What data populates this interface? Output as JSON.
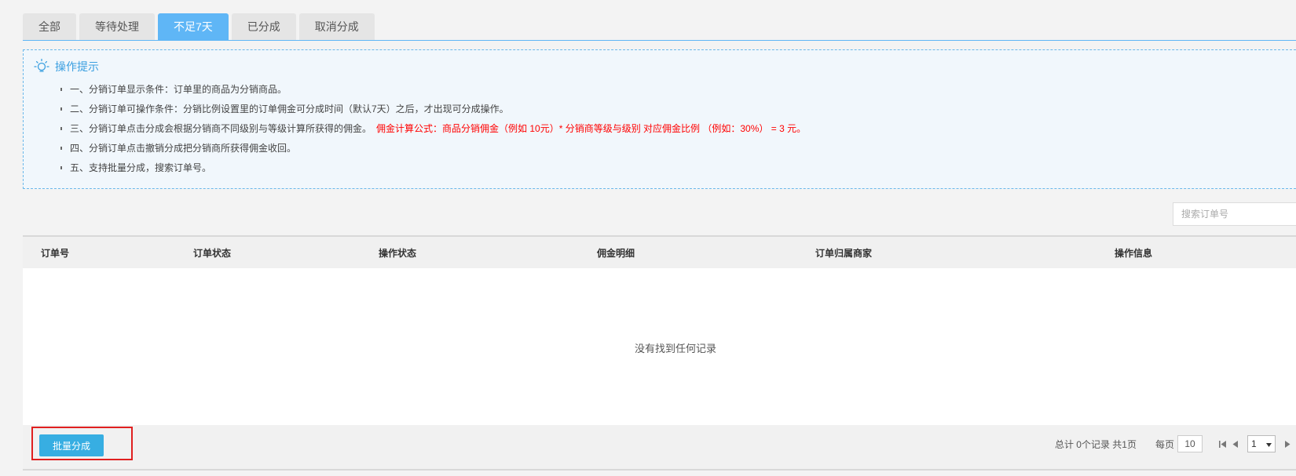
{
  "tabs": [
    {
      "label": "全部"
    },
    {
      "label": "等待处理"
    },
    {
      "label": "不足7天"
    },
    {
      "label": "已分成"
    },
    {
      "label": "取消分成"
    }
  ],
  "tips": {
    "title": "操作提示",
    "icon": "lightbulb-icon",
    "items": [
      "一、分销订单显示条件：订单里的商品为分销商品。",
      "二、分销订单可操作条件：分销比例设置里的订单佣金可分成时间（默认7天）之后，才出现可分成操作。",
      "三、分销订单点击分成会根据分销商不同级别与等级计算所获得的佣金。",
      "四、分销订单点击撤销分成把分销商所获得佣金收回。",
      "五、支持批量分成，搜索订单号。"
    ],
    "formula": "佣金计算公式：商品分销佣金（例如 10元）* 分销商等级与级别 对应佣金比例 （例如：30%） = 3 元。"
  },
  "search": {
    "placeholder": "搜索订单号",
    "value": ""
  },
  "table": {
    "columns": [
      "订单号",
      "订单状态",
      "操作状态",
      "佣金明细",
      "订单归属商家",
      "操作信息"
    ],
    "rows": [],
    "empty_text": "没有找到任何记录"
  },
  "footer": {
    "batch_button": "批量分成",
    "summary": "总计 0个记录 共1页",
    "per_page_label": "每页",
    "per_page_value": "10",
    "current_page": "1"
  },
  "colors": {
    "accent": "#5fb6f6",
    "button": "#37aee2",
    "highlight": "#e02020",
    "formula_red": "#ff0000"
  }
}
